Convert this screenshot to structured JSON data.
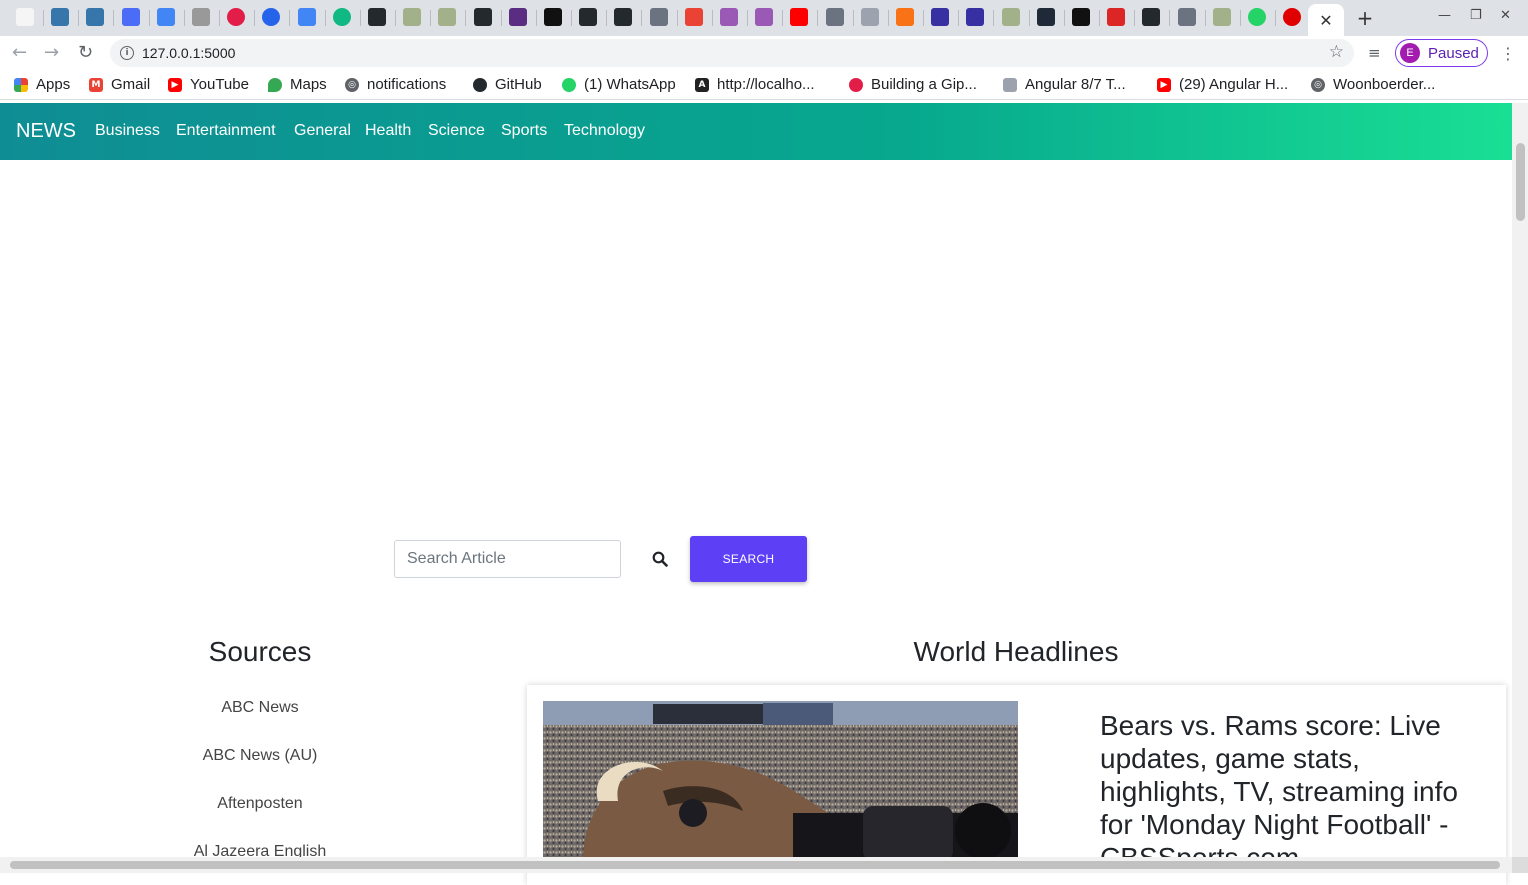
{
  "browser": {
    "url": "127.0.0.1:5000",
    "profile_initial": "E",
    "profile_status": "Paused",
    "close_tab_glyph": "✕",
    "new_tab_glyph": "+",
    "bookmarks": [
      {
        "label": "Apps",
        "icon": "apps-grid-icon",
        "color": "#ea4335"
      },
      {
        "label": "Gmail",
        "icon": "gmail-icon",
        "color": "#ea4335"
      },
      {
        "label": "YouTube",
        "icon": "youtube-icon",
        "color": "#ff0000"
      },
      {
        "label": "Maps",
        "icon": "maps-pin-icon",
        "color": "#34a853"
      },
      {
        "label": "notifications",
        "icon": "globe-icon",
        "color": "#5f6368"
      },
      {
        "label": "GitHub",
        "icon": "github-icon",
        "color": "#24292e"
      },
      {
        "label": "(1) WhatsApp",
        "icon": "whatsapp-icon",
        "color": "#25d366"
      },
      {
        "label": "http://localho...",
        "icon": "angular-icon",
        "color": "#222222"
      },
      {
        "label": "Building a Gip...",
        "icon": "site-icon",
        "color": "#e11d48"
      },
      {
        "label": "Angular 8/7 T...",
        "icon": "site-icon",
        "color": "#9ca3af"
      },
      {
        "label": "(29) Angular H...",
        "icon": "youtube-icon",
        "color": "#ff0000"
      },
      {
        "label": "Woonboerder...",
        "icon": "globe-icon",
        "color": "#5f6368"
      }
    ]
  },
  "nav": {
    "brand": "NEWS",
    "links": [
      "Business",
      "Entertainment",
      "General",
      "Health",
      "Science",
      "Sports",
      "Technology"
    ]
  },
  "search": {
    "placeholder": "Search Article",
    "button_label": "SEARCH"
  },
  "sources": {
    "title": "Sources",
    "items": [
      "ABC News",
      "ABC News (AU)",
      "Aftenposten",
      "Al Jazeera English"
    ]
  },
  "headlines": {
    "title": "World Headlines",
    "article": {
      "title": "Bears vs. Rams score: Live updates, game stats, highlights, TV, streaming info for 'Monday Night Football' - CBSSports.com"
    }
  },
  "colors": {
    "navbar_start": "#0f8d94",
    "navbar_end": "#19df94",
    "search_button": "#5d3ff6"
  }
}
